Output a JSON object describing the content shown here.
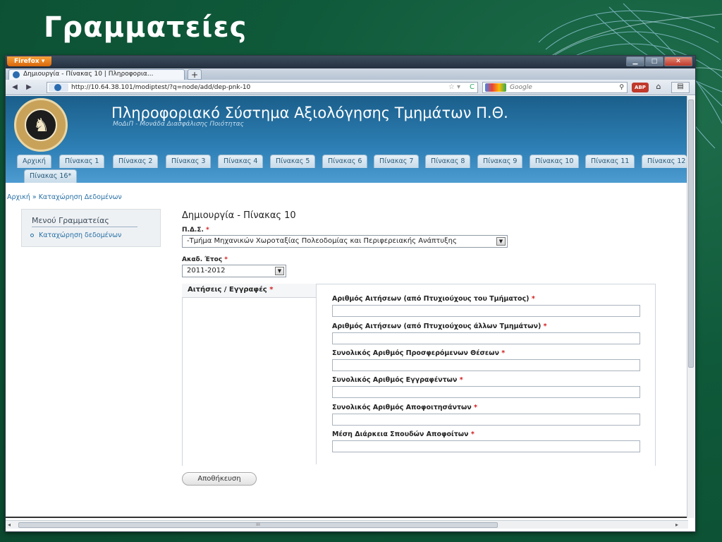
{
  "slide": {
    "title": "Γραμματείες"
  },
  "browser": {
    "app_button": "Firefox ▾",
    "tab_title": "Δημιουργία - Πίνακας 10 | Πληροφορια...",
    "new_tab": "+",
    "url": "http://10.64.38.101/modiptest/?q=node/add/dep-pnk-10",
    "search_placeholder": "Google",
    "abp": "ABP"
  },
  "site": {
    "name": "Πληροφοριακό Σύστημα Αξιολόγησης Τμημάτων Π.Θ.",
    "slogan": "ΜοΔιΠ - Μονάδα Διασφάλισης Ποιότητας"
  },
  "menu_tabs": [
    "Αρχική",
    "Πίνακας 1",
    "Πίνακας 2",
    "Πίνακας 3",
    "Πίνακας 4",
    "Πίνακας 5",
    "Πίνακας 6",
    "Πίνακας 7",
    "Πίνακας 8",
    "Πίνακας 9",
    "Πίνακας 10",
    "Πίνακας 11",
    "Πίνακας 12",
    "Πίνακας 16*"
  ],
  "breadcrumb": "Αρχική » Καταχώρηση Δεδομένων",
  "sidebar": {
    "title": "Μενού Γραμματείας",
    "item": "Καταχώρηση δεδομένων"
  },
  "form": {
    "title": "Δημιουργία - Πίνακας 10",
    "pds_label": "Π.Δ.Σ.",
    "pds_value": "-Τμήμα Μηχανικών Χωροταξίας Πολεοδομίας και Περιφερειακής Ανάπτυξης",
    "year_label": "Ακαδ. Έτος",
    "year_value": "2011-2012",
    "required_mark": "*",
    "group_title": "Αιτήσεις / Εγγραφές",
    "fields": [
      "Αριθμός Αιτήσεων (από Πτυχιούχους του Τμήματος)",
      "Αριθμός Αιτήσεων (από Πτυχιούχους άλλων Τμημάτων)",
      "Συνολικός Αριθμός Προσφερόμενων Θέσεων",
      "Συνολικός Αριθμός Εγγραφέντων",
      "Συνολικός Αριθμός Αποφοιτησάντων",
      "Μέση Διάρκεια Σπουδών Αποφοίτων"
    ],
    "save": "Αποθήκευση"
  }
}
